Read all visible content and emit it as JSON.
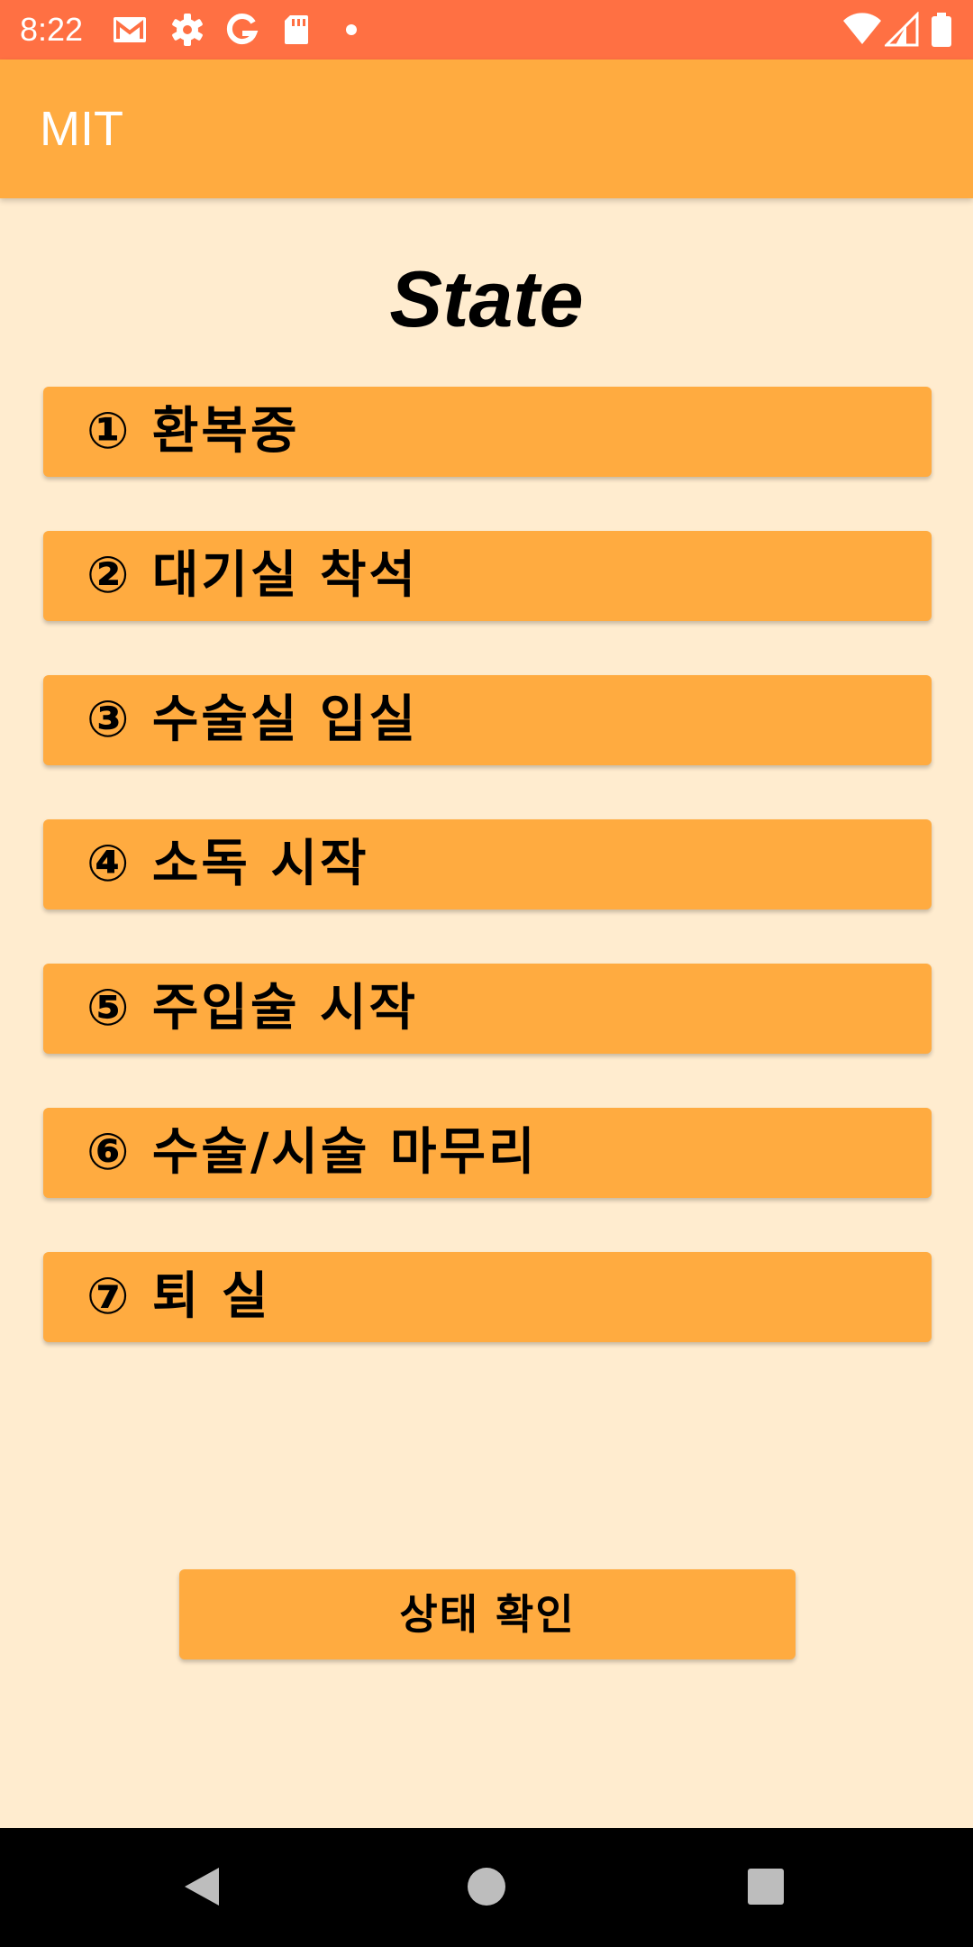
{
  "status_bar": {
    "time": "8:22",
    "icons": [
      "gmail-icon",
      "settings-icon",
      "google-icon",
      "sd-card-icon",
      "dot-icon",
      "wifi-icon",
      "signal-icon",
      "battery-icon"
    ]
  },
  "app_bar": {
    "title": "MIT"
  },
  "heading": "State",
  "state_buttons": [
    {
      "label": "① 환복중"
    },
    {
      "label": "② 대기실 착석"
    },
    {
      "label": "③ 수술실 입실"
    },
    {
      "label": "④ 소독 시작"
    },
    {
      "label": "⑤ 주입술 시작"
    },
    {
      "label": "⑥ 수술/시술 마무리"
    },
    {
      "label": "⑦ 퇴 실"
    }
  ],
  "check_button": {
    "label": "상태 확인"
  },
  "nav_bar": {
    "icons": [
      "back-icon",
      "home-icon",
      "recents-icon"
    ]
  },
  "colors": {
    "status_bar": "#FF7043",
    "accent": "#FFAB40",
    "background": "#FFECCF"
  }
}
